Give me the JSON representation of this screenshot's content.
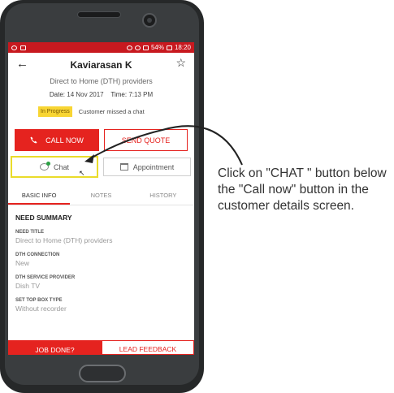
{
  "status_bar": {
    "battery": "54%",
    "time": "18:20"
  },
  "header": {
    "customer_name": "Kaviarasan K"
  },
  "service": "Direct to Home (DTH) providers",
  "datetime": {
    "date_label": "Date:",
    "date": "14 Nov 2017",
    "time_label": "Time:",
    "time": "7:13 PM"
  },
  "status": {
    "badge": "In Progress",
    "note": "Customer missed a chat"
  },
  "actions": {
    "call_now": "CALL NOW",
    "send_quote": "SEND QUOTE",
    "chat": "Chat",
    "appointment": "Appointment"
  },
  "tabs": [
    {
      "label": "BASIC INFO"
    },
    {
      "label": "NOTES"
    },
    {
      "label": "HISTORY"
    }
  ],
  "summary": {
    "title": "NEED SUMMARY",
    "fields": [
      {
        "label": "NEED TITLE",
        "value": "Direct to Home (DTH) providers"
      },
      {
        "label": "DTH CONNECTION",
        "value": "New"
      },
      {
        "label": "DTH SERVICE PROVIDER",
        "value": "Dish TV"
      },
      {
        "label": "SET TOP BOX TYPE",
        "value": "Without recorder"
      }
    ]
  },
  "bottom": {
    "job_done": "JOB DONE?",
    "lead_feedback": "LEAD FEEDBACK"
  },
  "instruction": "Click on \"CHAT \" button below the \"Call now\" button in the customer details screen.",
  "colors": {
    "accent": "#e5231f",
    "statusbar": "#c8191f",
    "highlight": "#eadc2a",
    "badge": "#f8d533"
  },
  "icons": [
    "back-arrow-icon",
    "star-icon",
    "phone-icon",
    "chat-icon",
    "calendar-icon",
    "cursor-icon"
  ]
}
